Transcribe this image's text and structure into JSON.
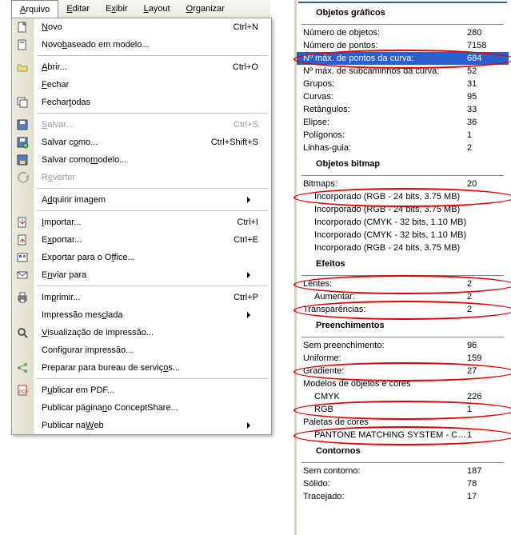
{
  "menubar": {
    "items": [
      {
        "pre": "",
        "u": "A",
        "post": "rquivo",
        "active": true
      },
      {
        "pre": "",
        "u": "E",
        "post": "ditar"
      },
      {
        "pre": "E",
        "u": "x",
        "post": "ibir"
      },
      {
        "pre": "",
        "u": "L",
        "post": "ayout"
      },
      {
        "pre": "",
        "u": "O",
        "post": "rganizar"
      }
    ]
  },
  "menu": {
    "items": [
      {
        "icon": "new",
        "pre": "",
        "u": "N",
        "post": "ovo",
        "shortcut": "Ctrl+N"
      },
      {
        "icon": "new-tpl",
        "pre": "Novo ",
        "u": "b",
        "post": "aseado em modelo...",
        "shortcut": ""
      },
      {
        "sep": true
      },
      {
        "icon": "open",
        "pre": "",
        "u": "A",
        "post": "brir...",
        "shortcut": "Ctrl+O"
      },
      {
        "icon": "",
        "pre": "",
        "u": "F",
        "post": "echar",
        "shortcut": ""
      },
      {
        "icon": "close-all",
        "pre": "Fechar ",
        "u": "t",
        "post": "odas",
        "shortcut": ""
      },
      {
        "sep": true
      },
      {
        "icon": "save",
        "pre": "",
        "u": "S",
        "post": "alvar...",
        "shortcut": "Ctrl+S",
        "disabled": true
      },
      {
        "icon": "save-as",
        "pre": "Salvar c",
        "u": "o",
        "post": "mo...",
        "shortcut": "Ctrl+Shift+S"
      },
      {
        "icon": "save-tpl",
        "pre": "Salvar como ",
        "u": "m",
        "post": "odelo...",
        "shortcut": ""
      },
      {
        "icon": "revert",
        "pre": "R",
        "u": "e",
        "post": "verter",
        "shortcut": "",
        "disabled": true
      },
      {
        "sep": true
      },
      {
        "icon": "",
        "pre": "A",
        "u": "d",
        "post": "quirir imagem",
        "submenu": true
      },
      {
        "sep": true
      },
      {
        "icon": "import",
        "pre": "",
        "u": "I",
        "post": "mportar...",
        "shortcut": "Ctrl+I"
      },
      {
        "icon": "export",
        "pre": "E",
        "u": "x",
        "post": "portar...",
        "shortcut": "Ctrl+E"
      },
      {
        "icon": "office",
        "pre": "Exportar para o O",
        "u": "f",
        "post": "fice...",
        "shortcut": ""
      },
      {
        "icon": "send",
        "pre": "E",
        "u": "n",
        "post": "viar para",
        "submenu": true
      },
      {
        "sep": true
      },
      {
        "icon": "print",
        "pre": "Im",
        "u": "p",
        "post": "rimir...",
        "shortcut": "Ctrl+P"
      },
      {
        "icon": "",
        "pre": "Impressão mes",
        "u": "c",
        "post": "lada",
        "submenu": true
      },
      {
        "icon": "preview",
        "pre": "",
        "u": "V",
        "post": "isualização de impressão...",
        "shortcut": ""
      },
      {
        "icon": "",
        "pre": "Confi",
        "u": "g",
        "post": "urar impressão...",
        "shortcut": ""
      },
      {
        "icon": "share",
        "pre": "Preparar para bureau de serviç",
        "u": "o",
        "post": "s...",
        "shortcut": ""
      },
      {
        "sep": true
      },
      {
        "icon": "pdf",
        "pre": "P",
        "u": "u",
        "post": "blicar em PDF...",
        "shortcut": ""
      },
      {
        "icon": "",
        "pre": "Publicar página ",
        "u": "n",
        "post": "o ConceptShare...",
        "shortcut": ""
      },
      {
        "icon": "",
        "pre": "Publicar na ",
        "u": "W",
        "post": "eb",
        "submenu": true
      }
    ]
  },
  "info": {
    "sections": [
      {
        "title": "Objetos gráficos",
        "rows": [
          {
            "l": "Número de objetos:",
            "v": "280"
          },
          {
            "l": "Número de pontos:",
            "v": "7158"
          },
          {
            "l": "Nº máx. de pontos da curva:",
            "v": "684",
            "sel": true,
            "ellipse": true
          },
          {
            "l": "Nº máx. de subcaminhos da curva:",
            "v": "52"
          },
          {
            "l": "Grupos:",
            "v": "31"
          },
          {
            "l": "Curvas:",
            "v": "95"
          },
          {
            "l": "Retângulos:",
            "v": "33"
          },
          {
            "l": "Elipse:",
            "v": "36"
          },
          {
            "l": "Polígonos:",
            "v": "1"
          },
          {
            "l": "Linhas-guia:",
            "v": "2"
          }
        ]
      },
      {
        "title": "Objetos bitmap",
        "rows": [
          {
            "l": "Bitmaps:",
            "v": "20"
          },
          {
            "l": "Incorporado (RGB - 24 bits, 3.75 MB)",
            "v": "",
            "indent": 1,
            "ellipse": true
          },
          {
            "l": "Incorporado (RGB - 24 bits, 3.75 MB)",
            "v": "",
            "indent": 1
          },
          {
            "l": "Incorporado (CMYK - 32 bits, 1.10 MB)",
            "v": "",
            "indent": 1
          },
          {
            "l": "Incorporado (CMYK - 32 bits, 1.10 MB)",
            "v": "",
            "indent": 1
          },
          {
            "l": "Incorporado (RGB - 24 bits, 3.75 MB)",
            "v": "",
            "indent": 1
          }
        ]
      },
      {
        "title": "Efeitos",
        "rows": [
          {
            "l": "Lentes:",
            "v": "2",
            "ellipse": true
          },
          {
            "l": "Aumentar:",
            "v": "2",
            "indent": 1
          },
          {
            "l": "Transparências:",
            "v": "2",
            "ellipse": true
          }
        ]
      },
      {
        "title": "Preenchimentos",
        "rows": [
          {
            "l": "Sem preenchimento:",
            "v": "96"
          },
          {
            "l": "Uniforme:",
            "v": "159"
          },
          {
            "l": "Gradiente:",
            "v": "27",
            "ellipse": true
          },
          {
            "l": "Modelos de objetos e cores",
            "v": ""
          },
          {
            "l": "CMYK",
            "v": "226",
            "indent": 1
          },
          {
            "l": "RGB",
            "v": "1",
            "indent": 1,
            "ellipse": true
          },
          {
            "l": "Paletas de cores",
            "v": ""
          },
          {
            "l": "PANTONE MATCHING SYSTEM - Cor...",
            "v": "1",
            "indent": 1,
            "ellipse": true
          }
        ]
      },
      {
        "title": "Contornos",
        "rows": [
          {
            "l": "Sem contorno:",
            "v": "187"
          },
          {
            "l": "Sólido:",
            "v": "78"
          },
          {
            "l": "Tracejado:",
            "v": "17"
          }
        ]
      }
    ]
  }
}
